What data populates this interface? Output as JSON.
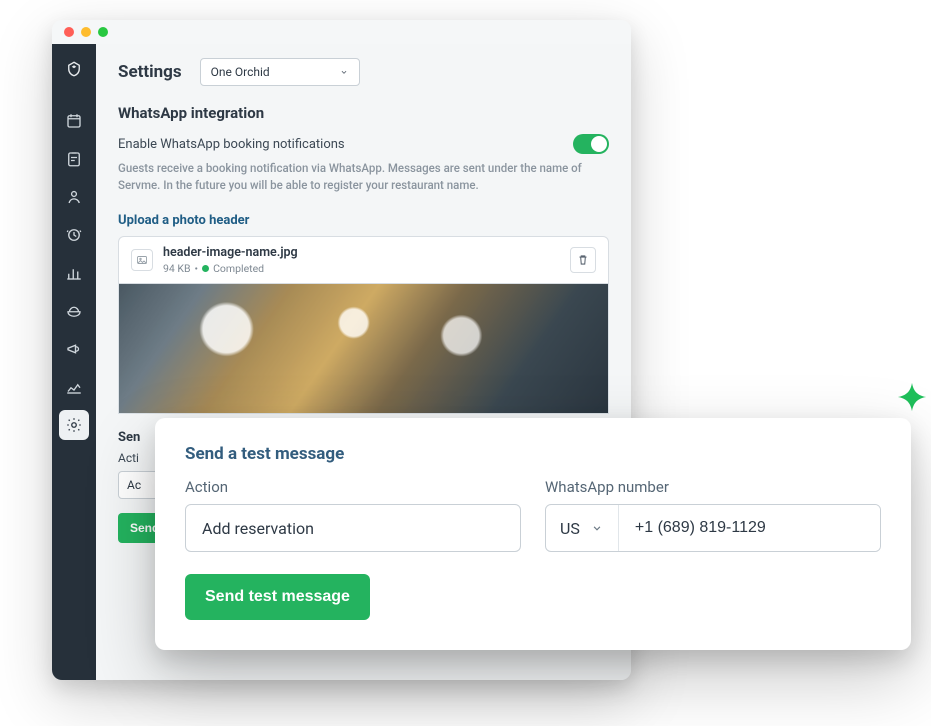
{
  "header": {
    "title": "Settings",
    "venue": "One Orchid"
  },
  "whatsapp": {
    "section_title": "WhatsApp integration",
    "toggle_label": "Enable WhatsApp booking notifications",
    "help_text": "Guests receive a booking notification via WhatsApp. Messages are sent under the name of Servme. In the future you will be able to register your restaurant name.",
    "upload_label": "Upload a photo header",
    "file": {
      "name": "header-image-name.jpg",
      "size": "94 KB",
      "status": "Completed"
    },
    "under": {
      "title": "Sen",
      "label": "Acti",
      "select_value": "Ac",
      "button": "Send test message"
    }
  },
  "popover": {
    "title": "Send a test message",
    "action_label": "Action",
    "action_value": "Add reservation",
    "number_label": "WhatsApp number",
    "country_code": "US",
    "phone_value": "+1 (689) 819-1129",
    "button": "Send test message"
  },
  "colors": {
    "accent_green": "#24b35f"
  }
}
